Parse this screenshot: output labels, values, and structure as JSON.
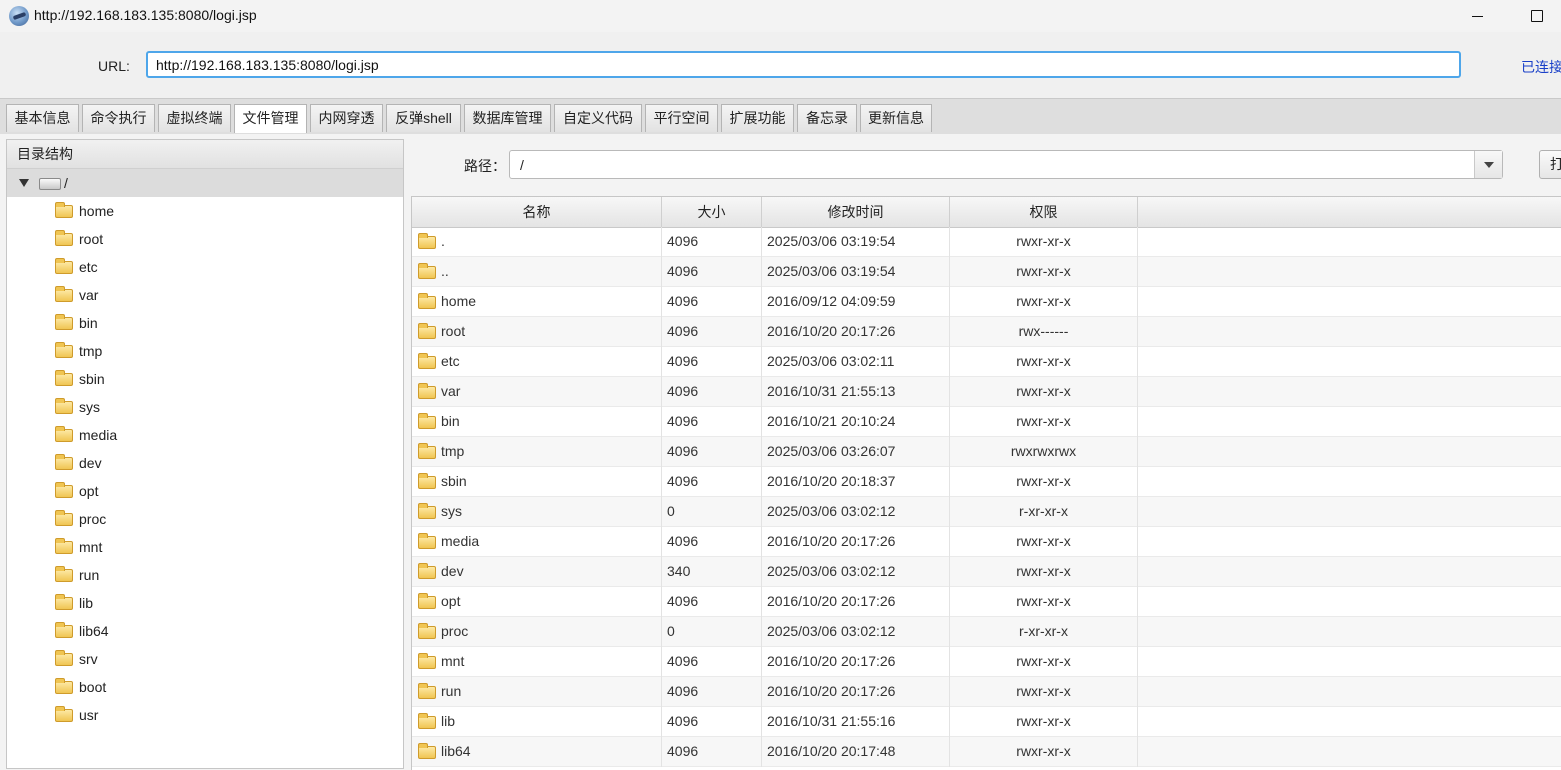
{
  "window": {
    "title": "http://192.168.183.135:8080/logi.jsp",
    "app_icon": "globe-app-icon",
    "minimize_icon": "minimize-icon",
    "maximize_icon": "maximize-icon"
  },
  "url_bar": {
    "label": "URL:",
    "value": "http://192.168.183.135:8080/logi.jsp",
    "status": "已连接"
  },
  "tabs": [
    {
      "label": "基本信息"
    },
    {
      "label": "命令执行"
    },
    {
      "label": "虚拟终端"
    },
    {
      "label": "文件管理",
      "active": true
    },
    {
      "label": "内网穿透"
    },
    {
      "label": "反弹shell"
    },
    {
      "label": "数据库管理"
    },
    {
      "label": "自定义代码"
    },
    {
      "label": "平行空间"
    },
    {
      "label": "扩展功能"
    },
    {
      "label": "备忘录"
    },
    {
      "label": "更新信息"
    }
  ],
  "tree": {
    "header": "目录结构",
    "root_label": "/",
    "items": [
      "home",
      "root",
      "etc",
      "var",
      "bin",
      "tmp",
      "sbin",
      "sys",
      "media",
      "dev",
      "opt",
      "proc",
      "mnt",
      "run",
      "lib",
      "lib64",
      "srv",
      "boot",
      "usr"
    ]
  },
  "path_bar": {
    "label": "路径：",
    "value": "/",
    "open_button": "打开"
  },
  "file_table": {
    "columns": [
      "名称",
      "大小",
      "修改时间",
      "权限"
    ],
    "rows": [
      {
        "name": ".",
        "size": "4096",
        "time": "2025/03/06 03:19:54",
        "perm": "rwxr-xr-x"
      },
      {
        "name": "..",
        "size": "4096",
        "time": "2025/03/06 03:19:54",
        "perm": "rwxr-xr-x"
      },
      {
        "name": "home",
        "size": "4096",
        "time": "2016/09/12 04:09:59",
        "perm": "rwxr-xr-x"
      },
      {
        "name": "root",
        "size": "4096",
        "time": "2016/10/20 20:17:26",
        "perm": "rwx------"
      },
      {
        "name": "etc",
        "size": "4096",
        "time": "2025/03/06 03:02:11",
        "perm": "rwxr-xr-x"
      },
      {
        "name": "var",
        "size": "4096",
        "time": "2016/10/31 21:55:13",
        "perm": "rwxr-xr-x"
      },
      {
        "name": "bin",
        "size": "4096",
        "time": "2016/10/21 20:10:24",
        "perm": "rwxr-xr-x"
      },
      {
        "name": "tmp",
        "size": "4096",
        "time": "2025/03/06 03:26:07",
        "perm": "rwxrwxrwx"
      },
      {
        "name": "sbin",
        "size": "4096",
        "time": "2016/10/20 20:18:37",
        "perm": "rwxr-xr-x"
      },
      {
        "name": "sys",
        "size": "0",
        "time": "2025/03/06 03:02:12",
        "perm": "r-xr-xr-x"
      },
      {
        "name": "media",
        "size": "4096",
        "time": "2016/10/20 20:17:26",
        "perm": "rwxr-xr-x"
      },
      {
        "name": "dev",
        "size": "340",
        "time": "2025/03/06 03:02:12",
        "perm": "rwxr-xr-x"
      },
      {
        "name": "opt",
        "size": "4096",
        "time": "2016/10/20 20:17:26",
        "perm": "rwxr-xr-x"
      },
      {
        "name": "proc",
        "size": "0",
        "time": "2025/03/06 03:02:12",
        "perm": "r-xr-xr-x"
      },
      {
        "name": "mnt",
        "size": "4096",
        "time": "2016/10/20 20:17:26",
        "perm": "rwxr-xr-x"
      },
      {
        "name": "run",
        "size": "4096",
        "time": "2016/10/20 20:17:26",
        "perm": "rwxr-xr-x"
      },
      {
        "name": "lib",
        "size": "4096",
        "time": "2016/10/31 21:55:16",
        "perm": "rwxr-xr-x"
      },
      {
        "name": "lib64",
        "size": "4096",
        "time": "2016/10/20 20:17:48",
        "perm": "rwxr-xr-x"
      }
    ]
  },
  "colors": {
    "accent_focus": "#4ea6ea",
    "status_link": "#1a40c8",
    "folder": "#f0c552"
  }
}
